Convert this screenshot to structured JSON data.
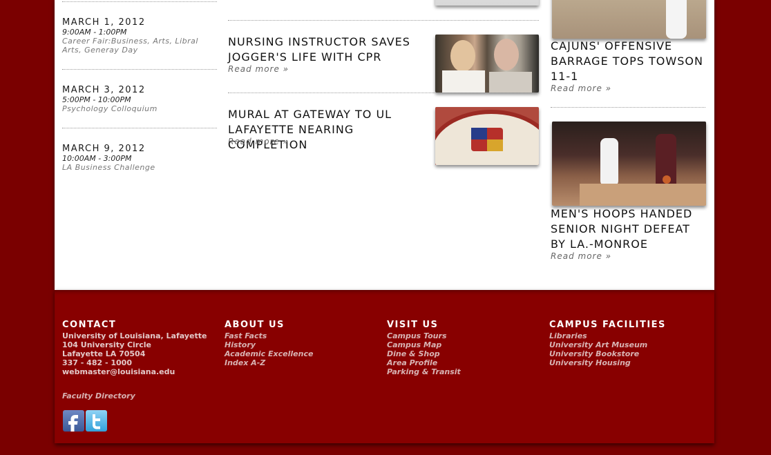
{
  "events": [
    {
      "date": "MARCH 1, 2012",
      "time": "9:00AM - 1:00PM",
      "desc": "Career Fair:Business, Arts, Libral Arts, Generay Day"
    },
    {
      "date": "MARCH 3, 2012",
      "time": "5:00PM - 10:00PM",
      "desc": "Psychology Colloquium"
    },
    {
      "date": "MARCH 9, 2012",
      "time": "10:00AM - 3:00PM",
      "desc": "LA Business Challenge"
    }
  ],
  "news": [
    {
      "title": "NURSING INSTRUCTOR SAVES JOGGER'S LIFE WITH CPR",
      "read_more": "Read more »"
    },
    {
      "title": "MURAL AT GATEWAY TO UL LAFAYETTE NEARING COMPLETION",
      "read_more": "Read more »"
    }
  ],
  "sports": [
    {
      "title": "CAJUNS' OFFENSIVE BARRAGE TOPS TOWSON 11-1",
      "read_more": "Read more »"
    },
    {
      "title": "MEN'S HOOPS HANDED SENIOR NIGHT DEFEAT BY LA.-MONROE",
      "read_more": "Read more »"
    }
  ],
  "footer": {
    "contact": {
      "heading": "CONTACT",
      "lines": [
        "University of Louisiana, Lafayette",
        "104 University Circle",
        "Lafayette LA 70504",
        "337 - 482 - 1000",
        "webmaster@louisiana.edu"
      ],
      "faculty_directory": "Faculty Directory"
    },
    "about": {
      "heading": "ABOUT US",
      "links": [
        "Fast Facts",
        "History",
        "Academic Excellence",
        "Index A-Z"
      ]
    },
    "visit": {
      "heading": "VISIT US",
      "links": [
        "Campus Tours",
        "Campus Map",
        "Dine & Shop",
        "Area Profile",
        "Parking & Transit"
      ]
    },
    "facilities": {
      "heading": "CAMPUS FACILITIES",
      "links": [
        "Libraries",
        "University Art Museum",
        "University Bookstore",
        "University Housing"
      ]
    },
    "social": {
      "facebook_icon": "facebook-icon",
      "twitter_icon": "twitter-icon"
    }
  },
  "colors": {
    "background": "#7a0000",
    "footer": "#880000",
    "page": "#ffffff"
  }
}
